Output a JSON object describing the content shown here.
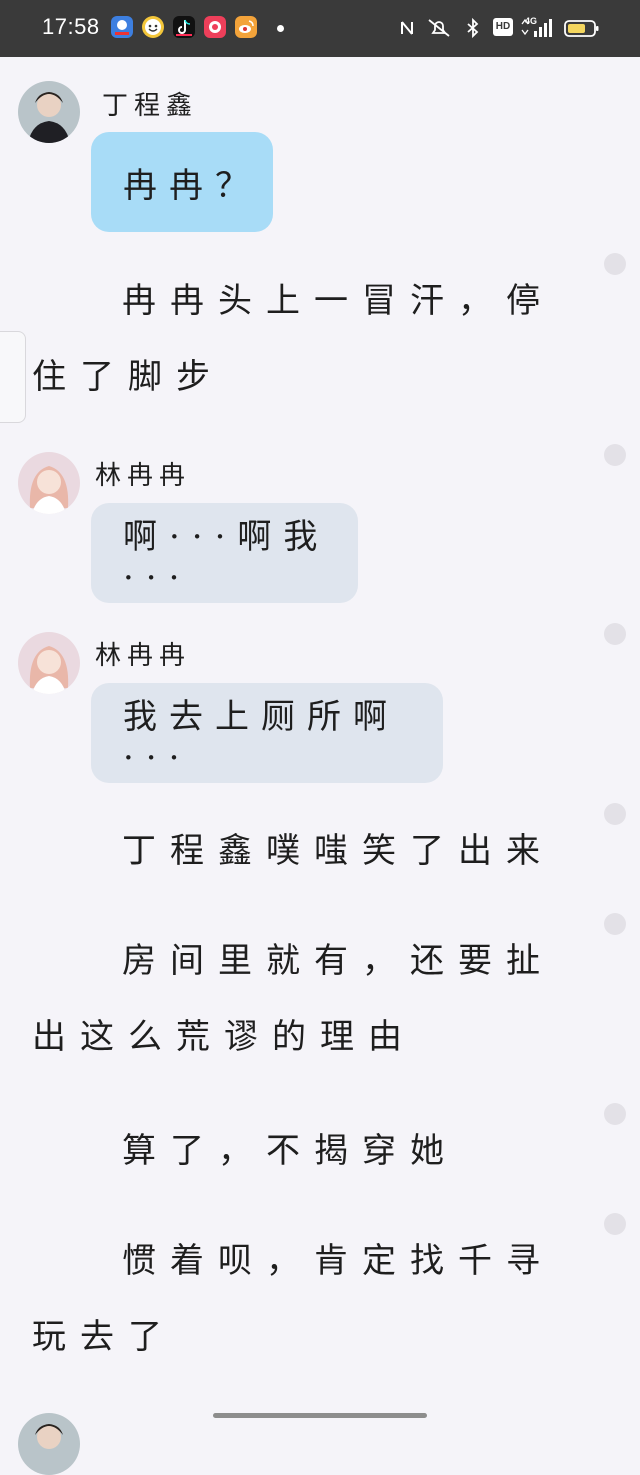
{
  "status_bar": {
    "time": "17:58",
    "network": "4G",
    "hd_label": "HD",
    "apps": [
      {
        "icon": "baidu-map-app-icon",
        "color": "#3d7fe0"
      },
      {
        "icon": "smiley-app-icon",
        "color": "#f3c63a"
      },
      {
        "icon": "tiktok-app-icon",
        "color": "#111111"
      },
      {
        "icon": "video-app-icon",
        "color": "#ee3f5a"
      },
      {
        "icon": "weibo-app-icon",
        "color": "#f3a33a"
      }
    ]
  },
  "messages": [
    {
      "type": "chat",
      "speaker": "丁程鑫",
      "text": "冉冉？",
      "bubble": "blue"
    },
    {
      "type": "narration",
      "text": "冉冉头上一冒汗，停住了脚步"
    },
    {
      "type": "chat",
      "speaker": "林冉冉",
      "text": "啊···啊我···",
      "bubble": "gray"
    },
    {
      "type": "chat",
      "speaker": "林冉冉",
      "text": "我去上厕所啊···",
      "bubble": "gray"
    },
    {
      "type": "narration",
      "text": "丁程鑫噗嗤笑了出来"
    },
    {
      "type": "narration",
      "text": "房间里就有，还要扯出这么荒谬的理由"
    },
    {
      "type": "narration",
      "text": "算了，不揭穿她"
    },
    {
      "type": "narration",
      "text": "惯着呗，肯定找千寻玩去了"
    }
  ],
  "colors": {
    "background": "#f5f4f9",
    "bubble_blue": "#a8dcf7",
    "bubble_gray": "#dfe5ee",
    "status_bar": "#3a3a3a"
  }
}
